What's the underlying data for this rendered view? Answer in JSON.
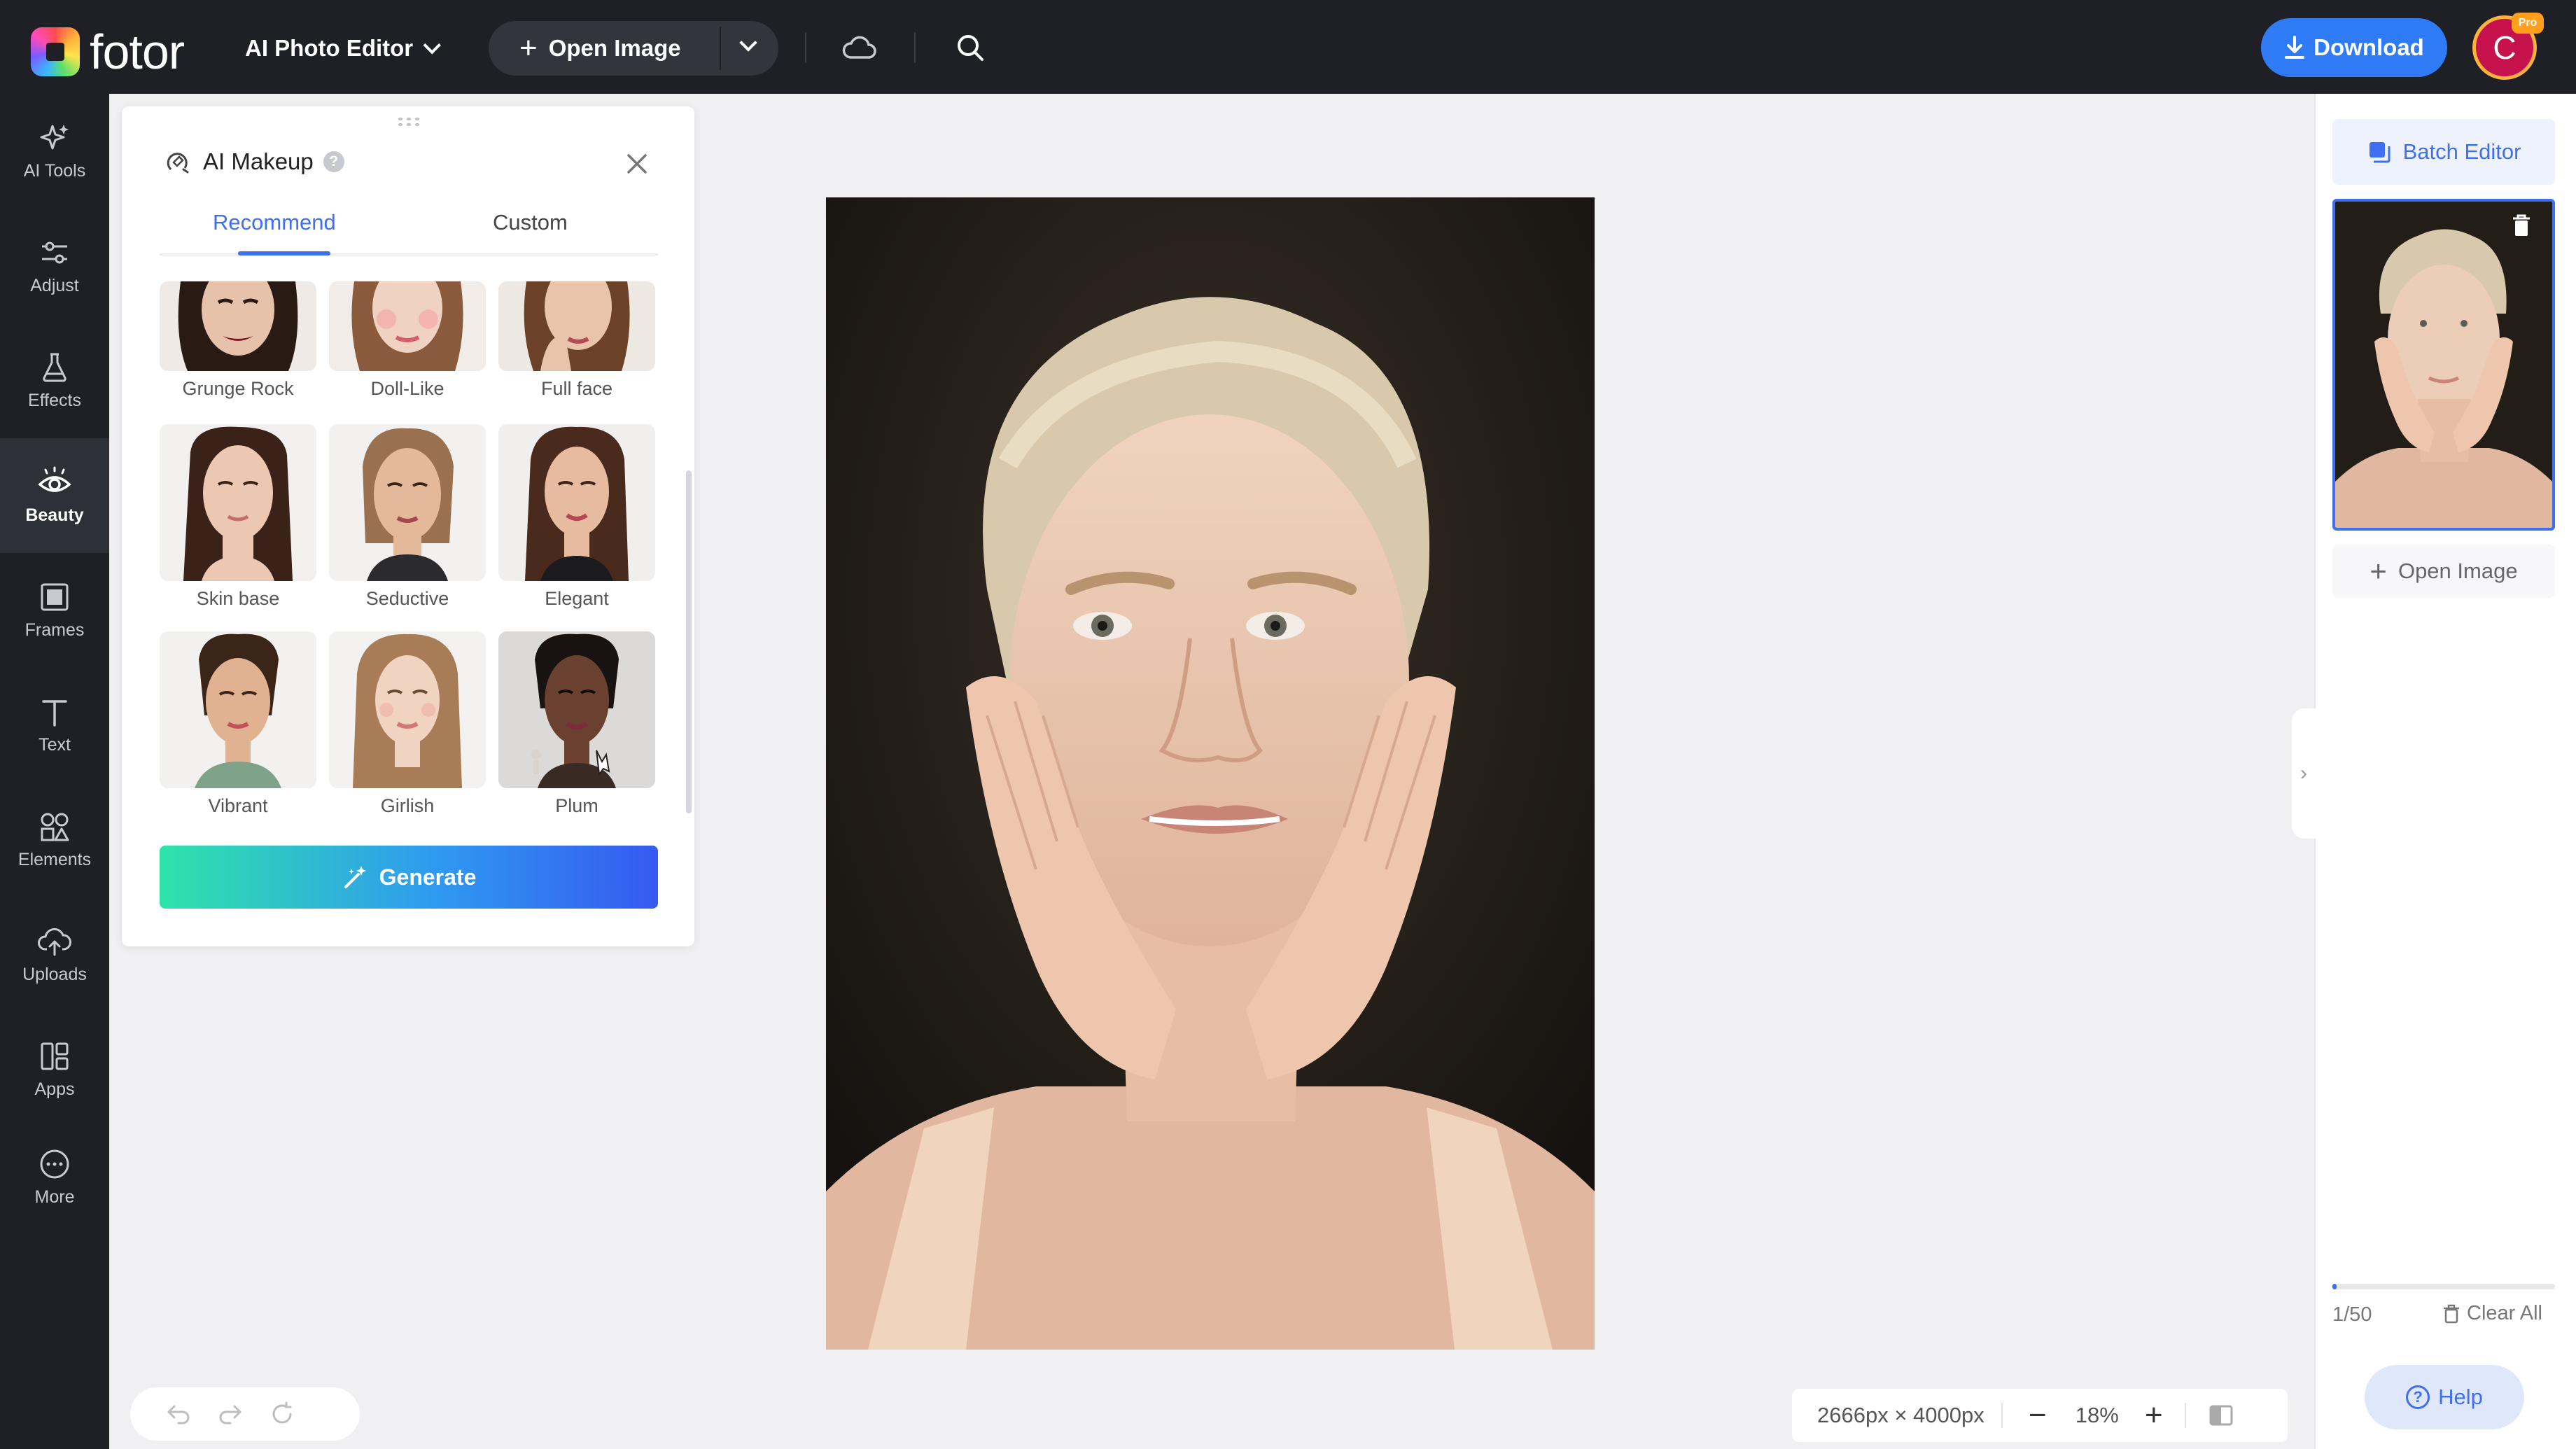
{
  "topbar": {
    "logo_text": "fotor",
    "editor_menu": "AI Photo Editor",
    "open_image": "Open Image",
    "download": "Download",
    "avatar_initial": "C",
    "pro_badge": "Pro"
  },
  "leftnav": {
    "items": [
      {
        "label": "AI Tools",
        "icon": "ai-tools-icon"
      },
      {
        "label": "Adjust",
        "icon": "sliders-icon"
      },
      {
        "label": "Effects",
        "icon": "flask-icon"
      },
      {
        "label": "Beauty",
        "icon": "eye-icon"
      },
      {
        "label": "Frames",
        "icon": "frame-icon"
      },
      {
        "label": "Text",
        "icon": "text-icon"
      },
      {
        "label": "Elements",
        "icon": "shapes-icon"
      },
      {
        "label": "Uploads",
        "icon": "cloud-upload-icon"
      },
      {
        "label": "Apps",
        "icon": "apps-icon"
      },
      {
        "label": "More",
        "icon": "more-icon"
      }
    ],
    "active": "Beauty"
  },
  "panel": {
    "title": "AI Makeup",
    "help_glyph": "?",
    "tabs": [
      "Recommend",
      "Custom"
    ],
    "active_tab": "Recommend",
    "styles": [
      {
        "label": "Grunge Rock"
      },
      {
        "label": "Doll-Like"
      },
      {
        "label": "Full face"
      },
      {
        "label": "Skin base"
      },
      {
        "label": "Seductive"
      },
      {
        "label": "Elegant"
      },
      {
        "label": "Vibrant"
      },
      {
        "label": "Girlish"
      },
      {
        "label": "Plum"
      }
    ],
    "generate": "Generate"
  },
  "rightpanel": {
    "batch_editor": "Batch Editor",
    "open_image": "Open Image",
    "count": "1/50",
    "count_progress": 0.02,
    "clear_all": "Clear All",
    "help": "Help"
  },
  "zoom": {
    "dimensions": "2666px × 4000px",
    "minus": "−",
    "value": "18%",
    "plus": "+"
  },
  "colors": {
    "accent": "#3e6ff0",
    "download": "#2f7bf5",
    "dark_bar": "#1f2026"
  }
}
